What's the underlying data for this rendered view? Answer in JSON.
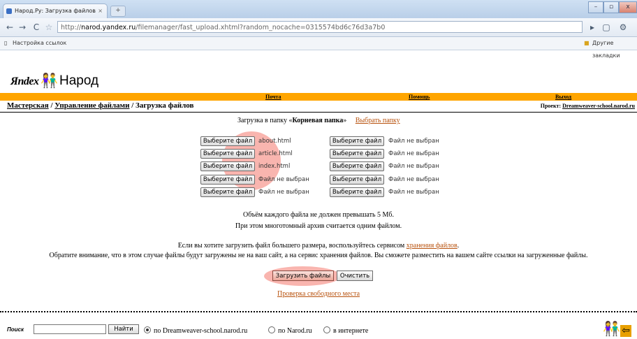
{
  "browser": {
    "tab_title": "Народ.Ру: Загрузка файлов",
    "tab_close": "×",
    "url_prefix": "http://",
    "url_domain": "narod.yandex.ru",
    "url_path": "/filemanager/fast_upload.xhtml?random_nocache=0315574bd6c76d3a7b0",
    "bookmark_left": "Настройка ссылок",
    "bookmark_right": "Другие закладки"
  },
  "logo": {
    "yandex": "Яndex",
    "narod": "Народ"
  },
  "topnav": {
    "mail": "Почта",
    "help": "Помощь",
    "exit": "Выход"
  },
  "breadcrumb": {
    "item1": "Мастерская",
    "sep1": " / ",
    "item2": "Управление файлами",
    "sep2": " / ",
    "current": "Загрузка файлов"
  },
  "project": {
    "label": "Проект: ",
    "name": "Dreamweaver-school.narod.ru"
  },
  "folder": {
    "prefix": "Загрузка в папку «",
    "name": "Корневая папка",
    "suffix": "»",
    "choose_link": "Выбрать папку"
  },
  "file_button_label": "Выберите файл",
  "files_left": [
    "about.html",
    "article.html",
    "index.html",
    "Файл не выбран",
    "Файл не выбран"
  ],
  "files_right": [
    "Файл не выбран",
    "Файл не выбран",
    "Файл не выбран",
    "Файл не выбран",
    "Файл не выбран"
  ],
  "notes": {
    "size_limit": "Объём каждого файла не должен превышать 5 Мб.",
    "multivolume": "При этом многотомный архив считается одним файлом.",
    "bigger_prefix": "Если вы хотите загрузить файл большего размера, воспользуйтесь сервисом ",
    "bigger_link": "хранения файлов",
    "bigger_suffix": ".",
    "warning": "Обратите внимание, что в этом случае файлы будут загружены не на ваш сайт, а на сервис хранения файлов. Вы сможете разместить на вашем сайте ссылки на загруженные файлы."
  },
  "actions": {
    "upload": "Загрузить файлы",
    "clear": "Очистить",
    "check_space": "Проверка свободного места"
  },
  "search": {
    "label": "Поиск",
    "value": "",
    "button": "Найти",
    "options": [
      "по Dreamweaver-school.narod.ru",
      "по Narod.ru",
      "в интернете"
    ],
    "selected": "по Dreamweaver-school.narod.ru"
  },
  "colors": {
    "accent_bar": "#ffa500",
    "link": "#b8520e",
    "highlight": "#f4786e"
  }
}
